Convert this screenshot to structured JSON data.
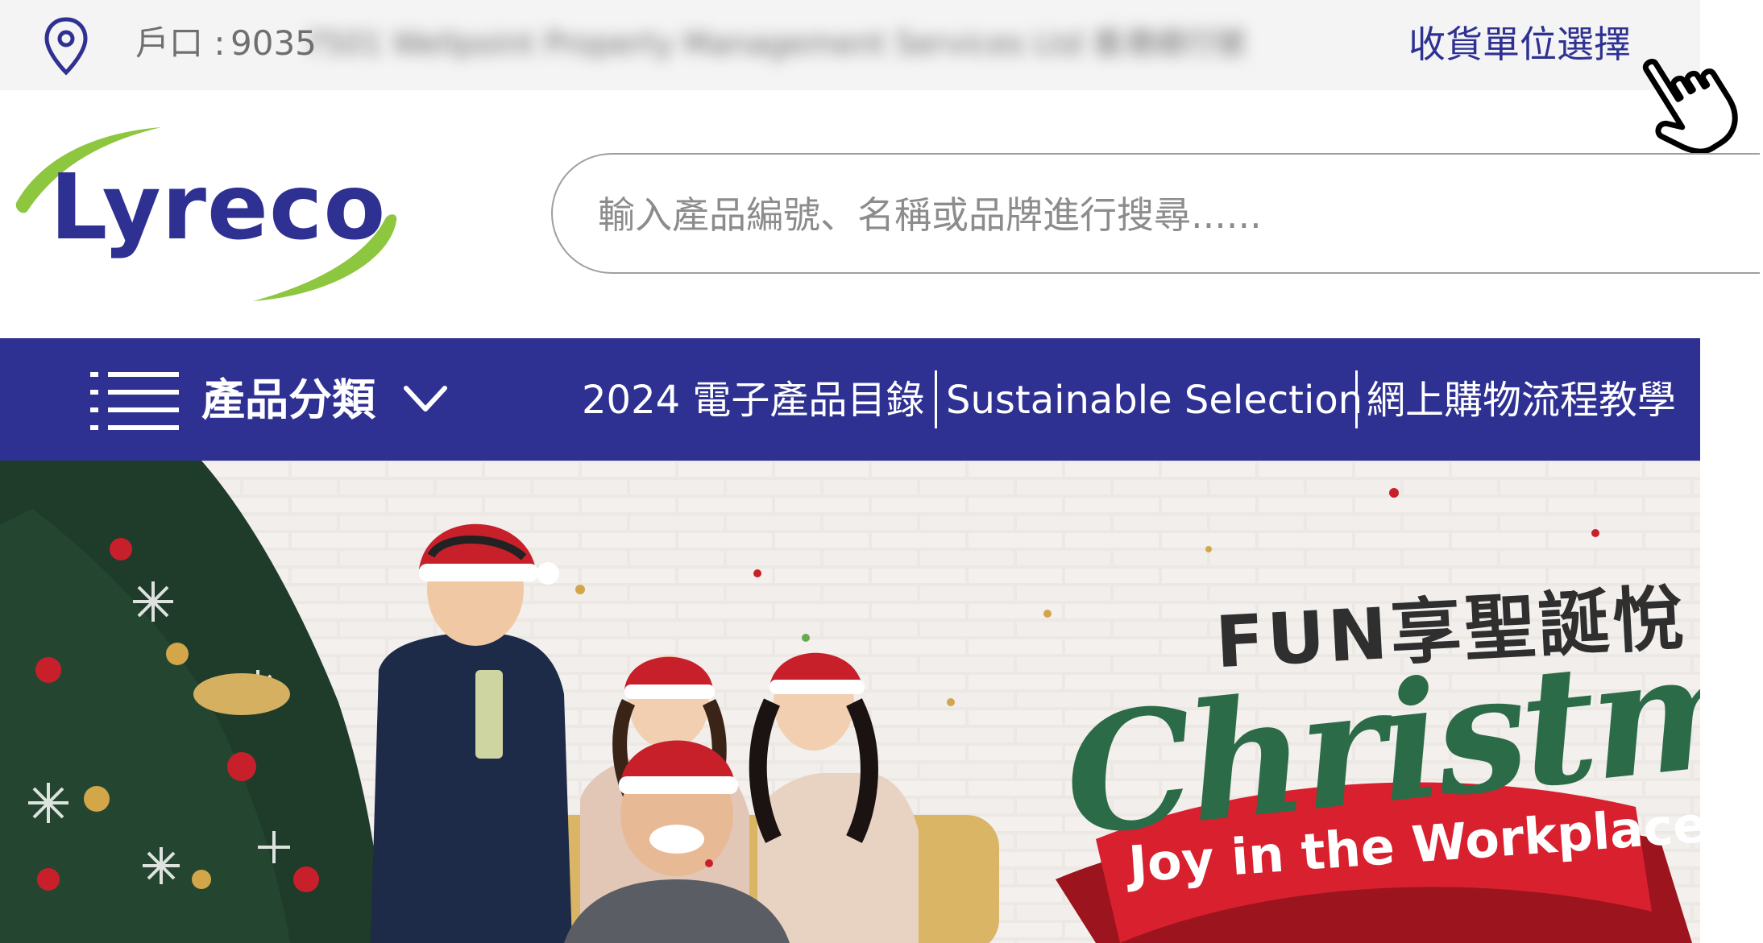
{
  "top_bar": {
    "account_label": "戶口 :",
    "account_value": "9035",
    "account_obscured": "7501 Wellpoint Property Management Services Ltd 香港總行號",
    "delivery_link": "收貨單位選擇"
  },
  "header": {
    "logo_text": "Lyreco",
    "search_placeholder": "輸入產品編號、名稱或品牌進行搜尋......"
  },
  "nav": {
    "category_label": "產品分類",
    "links": [
      "2024 電子產品目錄",
      "Sustainable Selection",
      "網上購物流程教學"
    ]
  },
  "hero": {
    "headline": "FUN享聖誕悅",
    "script_title": "Christmas",
    "ribbon": "Joy in the Workplace"
  },
  "colors": {
    "brand_blue": "#2e3192",
    "brand_green": "#8dc63f",
    "ribbon_red": "#d8202e",
    "script_green": "#2c6b47"
  },
  "icons": [
    "location-pin-icon",
    "hand-pointer-cursor-icon",
    "hamburger-menu-icon",
    "chevron-down-icon"
  ]
}
